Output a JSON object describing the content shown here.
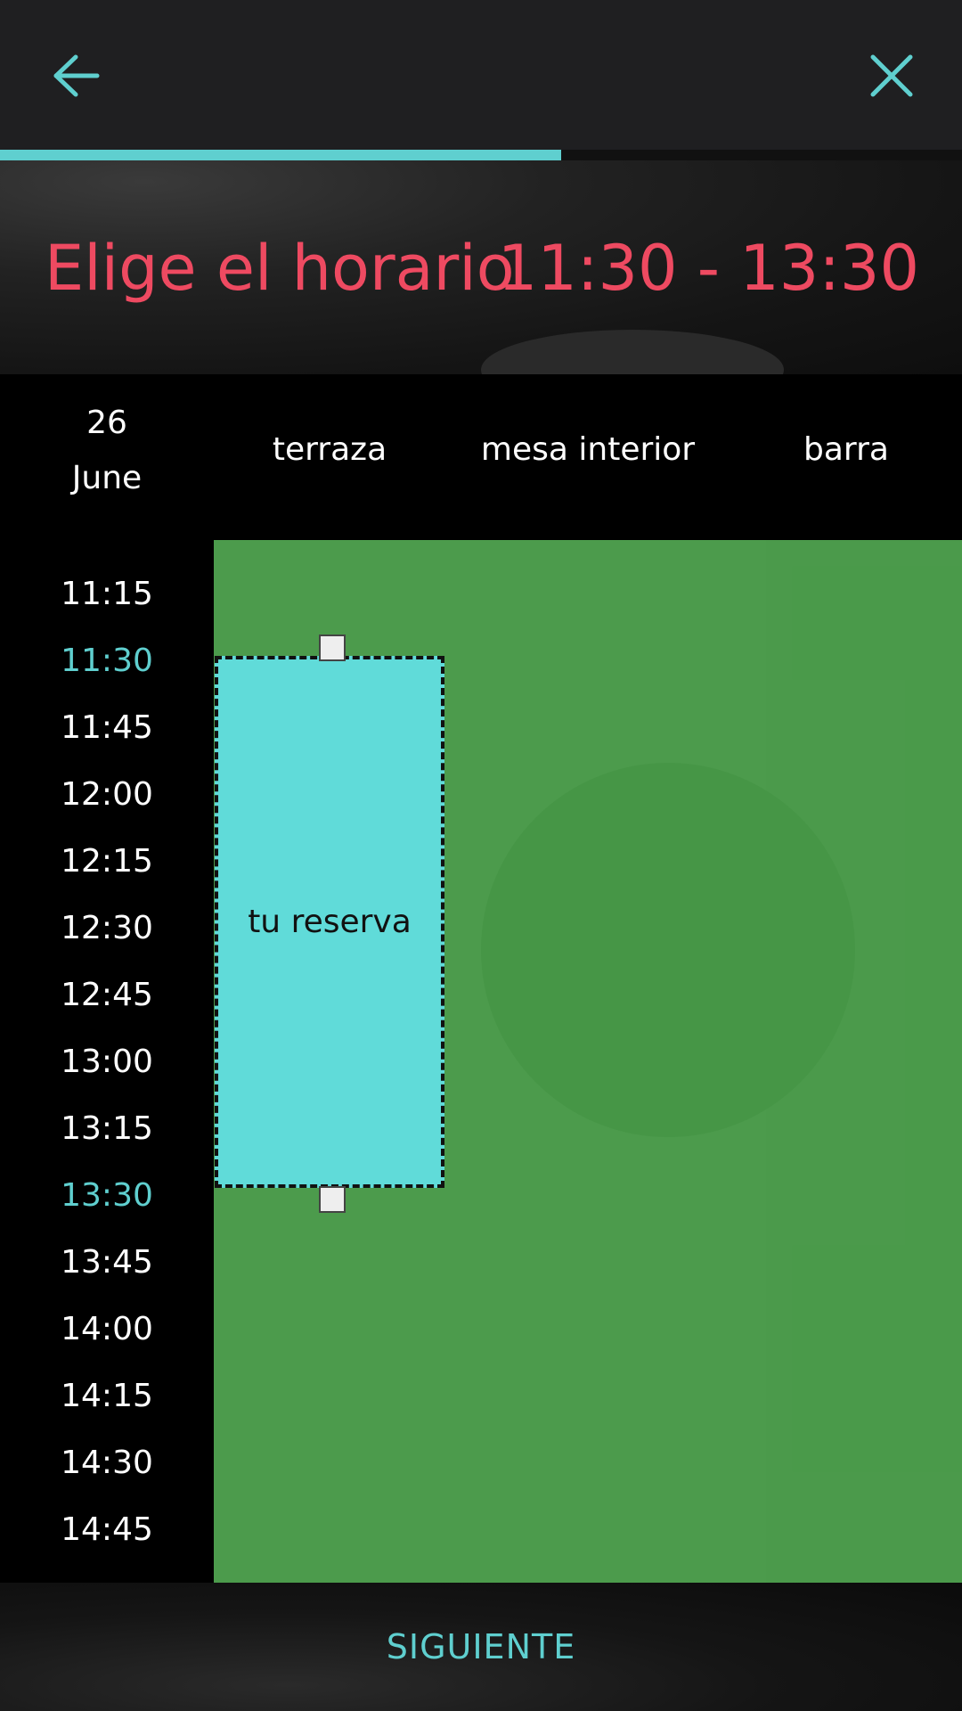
{
  "colors": {
    "accent": "#5fcfcf",
    "title": "#ee4a61",
    "available": "#4c9b4c",
    "reservation": "#60dbd9",
    "topbar": "#1f1f21"
  },
  "nav": {
    "back_icon": "arrow-left-icon",
    "close_icon": "close-icon",
    "progress": 0.583
  },
  "hero": {
    "title": "Elige el horario",
    "range": "11:30 - 13:30"
  },
  "schedule": {
    "date_day": "26",
    "date_month": "June",
    "columns": [
      {
        "label": "terraza"
      },
      {
        "label": "mesa interior"
      },
      {
        "label": "barra"
      }
    ],
    "times": [
      {
        "label": "11:15",
        "highlight": false
      },
      {
        "label": "11:30",
        "highlight": true
      },
      {
        "label": "11:45",
        "highlight": false
      },
      {
        "label": "12:00",
        "highlight": false
      },
      {
        "label": "12:15",
        "highlight": false
      },
      {
        "label": "12:30",
        "highlight": false
      },
      {
        "label": "12:45",
        "highlight": false
      },
      {
        "label": "13:00",
        "highlight": false
      },
      {
        "label": "13:15",
        "highlight": false
      },
      {
        "label": "13:30",
        "highlight": true
      },
      {
        "label": "13:45",
        "highlight": false
      },
      {
        "label": "14:00",
        "highlight": false
      },
      {
        "label": "14:15",
        "highlight": false
      },
      {
        "label": "14:30",
        "highlight": false
      },
      {
        "label": "14:45",
        "highlight": false
      }
    ],
    "reservation": {
      "label": "tu reserva",
      "column": "terraza",
      "start": "11:30",
      "end": "13:30"
    }
  },
  "footer": {
    "next_label": "SIGUIENTE"
  }
}
